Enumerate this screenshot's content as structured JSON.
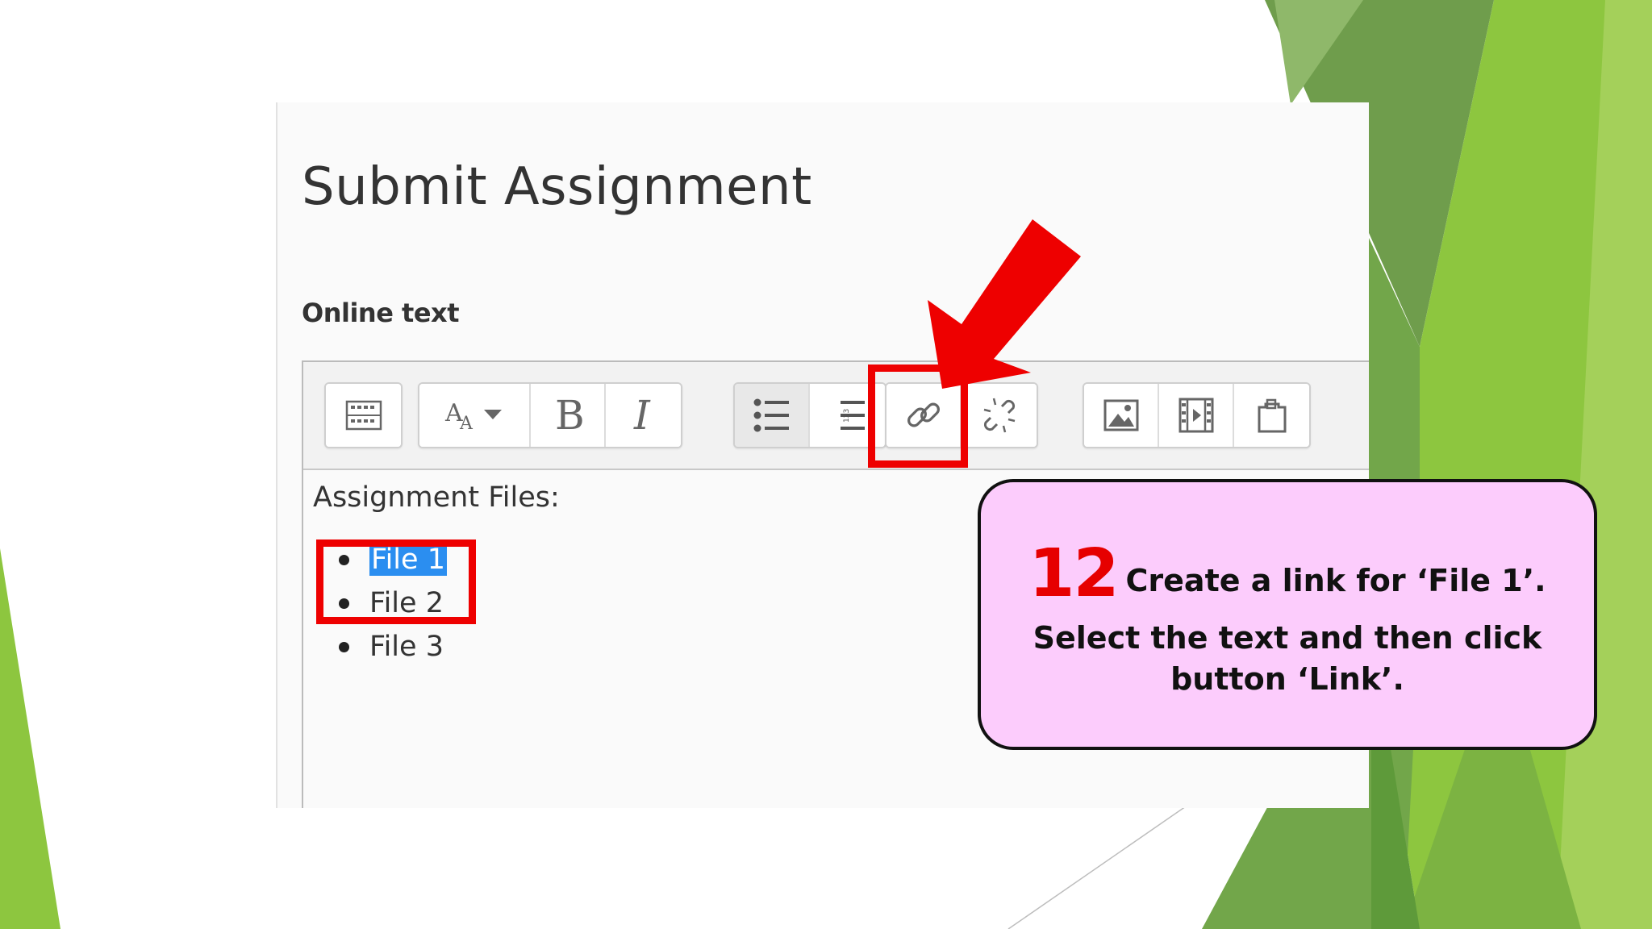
{
  "colors": {
    "accent_red": "#ee0000",
    "callout_bg": "#fcccfc",
    "selection_blue": "#2b8ef0",
    "deco_green": "#8dc63f"
  },
  "screenshot": {
    "page_title": "Submit Assignment",
    "section_label": "Online text",
    "toolbar": {
      "buttons": [
        {
          "name": "show-more-buttons",
          "icon": "toolbar-toggle-icon"
        },
        {
          "name": "font-size",
          "icon": "font-size-icon",
          "label": "A"
        },
        {
          "name": "bold",
          "icon": "bold-icon",
          "label": "B"
        },
        {
          "name": "italic",
          "icon": "italic-icon",
          "label": "I"
        },
        {
          "name": "unordered-list",
          "icon": "bulleted-list-icon",
          "state": "active"
        },
        {
          "name": "ordered-list",
          "icon": "numbered-list-icon",
          "label": "123"
        },
        {
          "name": "link",
          "icon": "link-icon"
        },
        {
          "name": "unlink",
          "icon": "unlink-icon"
        },
        {
          "name": "insert-image",
          "icon": "image-icon"
        },
        {
          "name": "insert-media",
          "icon": "media-icon"
        },
        {
          "name": "manage-files",
          "icon": "files-icon"
        }
      ]
    },
    "content": {
      "label": "Assignment Files:",
      "files": [
        {
          "text": "File 1",
          "selected": true
        },
        {
          "text": "File 2",
          "selected": false
        },
        {
          "text": "File 3",
          "selected": false
        }
      ]
    }
  },
  "callout": {
    "step_number": "12",
    "title": "Create a link for ‘File 1’.",
    "body_line1": "Select the text and then click",
    "body_line2": "button ‘Link’."
  }
}
